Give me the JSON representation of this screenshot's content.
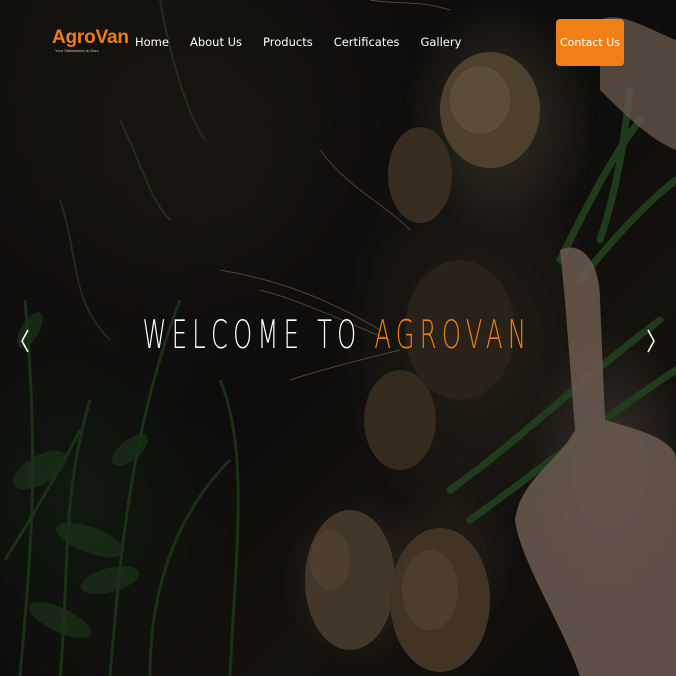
{
  "brand": {
    "logo_text": "AgroVan",
    "tagline": "Your Satisfaction is Ours",
    "accent_color": "#ef7d14"
  },
  "nav": {
    "items": [
      {
        "label": "Home"
      },
      {
        "label": "About Us"
      },
      {
        "label": "Products"
      },
      {
        "label": "Certificates"
      },
      {
        "label": "Gallery"
      }
    ],
    "cta_label": "Contact Us"
  },
  "hero": {
    "title_prefix": "WELCOME TO",
    "title_highlight": "AGROVAN",
    "background_description_icon": "onion-harvest-photo",
    "prev_icon": "chevron-left-icon",
    "next_icon": "chevron-right-icon"
  }
}
